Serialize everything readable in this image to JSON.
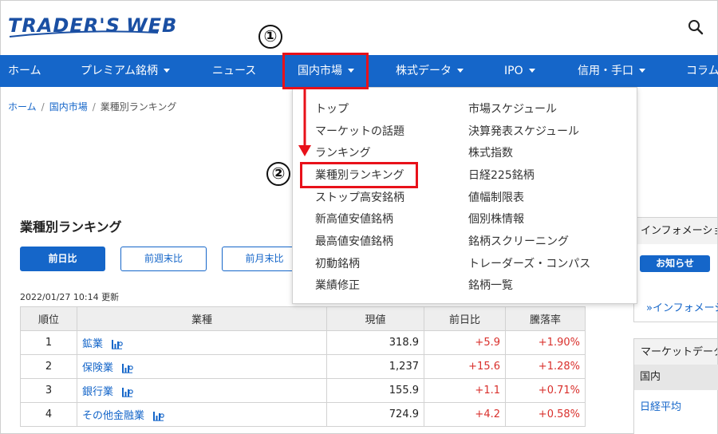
{
  "header": {
    "logo_primary": "TRADER'S",
    "logo_secondary": "WEB",
    "search_icon": "search-icon"
  },
  "nav": {
    "items": [
      {
        "label": "ホーム",
        "has_caret": false
      },
      {
        "label": "プレミアム銘柄",
        "has_caret": true
      },
      {
        "label": "ニュース",
        "has_caret": false
      },
      {
        "label": "国内市場",
        "has_caret": true
      },
      {
        "label": "株式データ",
        "has_caret": true
      },
      {
        "label": "IPO",
        "has_caret": true
      },
      {
        "label": "信用・手口",
        "has_caret": true
      },
      {
        "label": "コラム",
        "has_caret": false
      }
    ],
    "bar_color": "#1566c9"
  },
  "breadcrumb": {
    "home": "ホーム",
    "market": "国内市場",
    "current": "業種別ランキング",
    "separator": "/"
  },
  "dropdown": {
    "left_column": [
      "トップ",
      "マーケットの話題",
      "ランキング",
      "業種別ランキング",
      "ストップ高安銘柄",
      "新高値安値銘柄",
      "最高値安値銘柄",
      "初動銘柄",
      "業績修正"
    ],
    "right_column": [
      "市場スケジュール",
      "決算発表スケジュール",
      "株式指数",
      "日経225銘柄",
      "値幅制限表",
      "個別株情報",
      "銘柄スクリーニング",
      "トレーダーズ・コンパス",
      "銘柄一覧"
    ]
  },
  "annotations": {
    "step1": "①",
    "step2": "②",
    "highlight_color": "#e8111a"
  },
  "main": {
    "title": "業種別ランキング",
    "period_buttons": [
      {
        "label": "前日比",
        "active": true
      },
      {
        "label": "前週末比",
        "active": false
      },
      {
        "label": "前月末比",
        "active": false
      }
    ],
    "updated": "2022/01/27 10:14 更新"
  },
  "table": {
    "headers": [
      "順位",
      "業種",
      "現値",
      "前日比",
      "騰落率"
    ],
    "rows": [
      {
        "rank": "1",
        "industry": "鉱業",
        "value": "318.9",
        "change": "+5.9",
        "pct": "+1.90%"
      },
      {
        "rank": "2",
        "industry": "保険業",
        "value": "1,237",
        "change": "+15.6",
        "pct": "+1.28%"
      },
      {
        "rank": "3",
        "industry": "銀行業",
        "value": "155.9",
        "change": "+1.1",
        "pct": "+0.71%"
      },
      {
        "rank": "4",
        "industry": "その他金融業",
        "value": "724.9",
        "change": "+4.2",
        "pct": "+0.58%"
      }
    ],
    "positive_color": "#d9302c"
  },
  "sidebar": {
    "info_head": "インフォメーション",
    "notice_button": "お知らせ",
    "info_link": "»インフォメーション",
    "market_head": "マーケットデータ",
    "domestic": "国内",
    "nikkei": "日経平均"
  }
}
